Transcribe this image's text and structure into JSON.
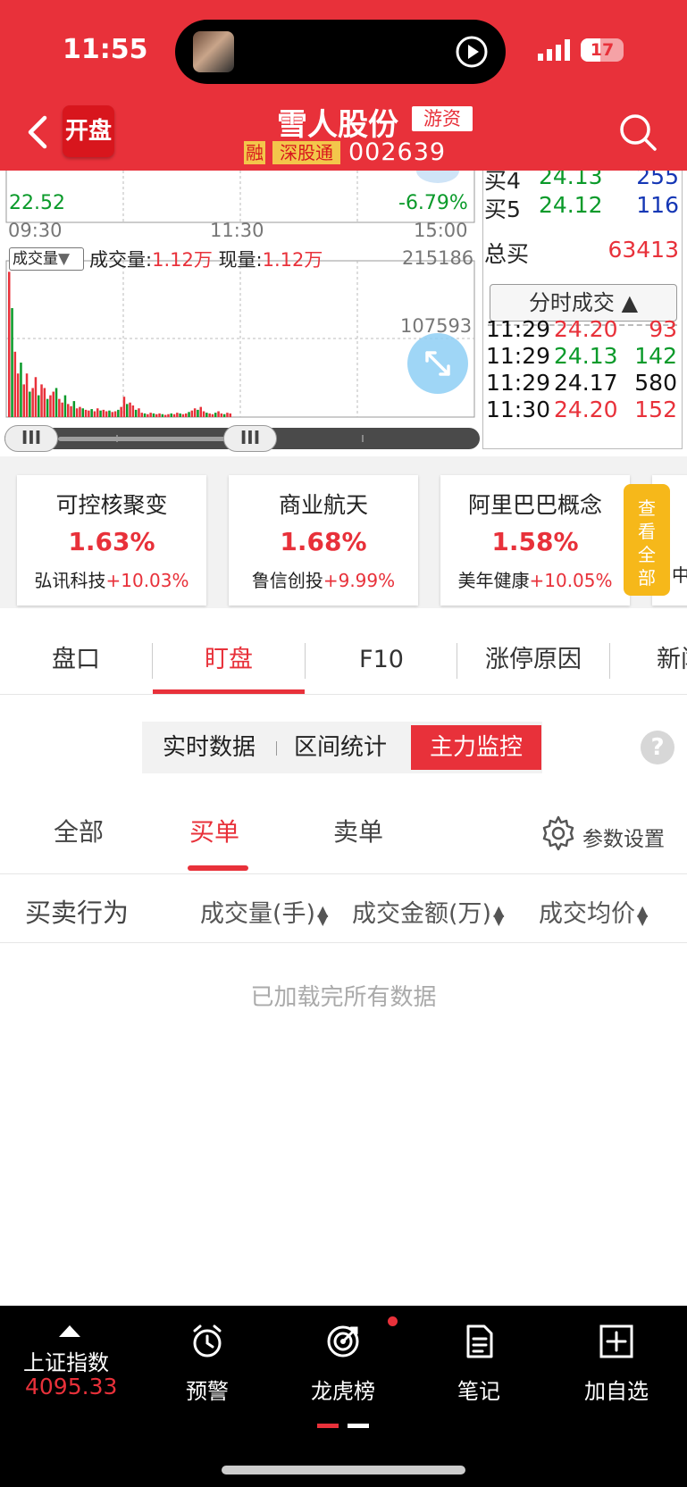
{
  "status_bar": {
    "time": "11:55",
    "battery": "17"
  },
  "header": {
    "kaipan_label": "开盘",
    "stock_name": "雪人股份",
    "tag": "游资",
    "rong": "融",
    "shen_gu_tong": "深股通",
    "code": "002639"
  },
  "chart": {
    "price_low": "22.52",
    "pct_low": "-6.79%",
    "time_labels": [
      "09:30",
      "11:30",
      "15:00"
    ],
    "volume_selector": "成交量",
    "volume_label": "成交量:",
    "volume_value": "1.12万",
    "current_label": "现量:",
    "current_value": "1.12万",
    "vol_max": "215186",
    "vol_mid": "107593"
  },
  "chart_data": {
    "type": "bar",
    "title": "",
    "ylim": [
      0,
      215186
    ],
    "values": [
      200000,
      150000,
      90000,
      60000,
      75000,
      45000,
      60000,
      35000,
      40000,
      55000,
      30000,
      45000,
      40000,
      25000,
      30000,
      35000,
      40000,
      25000,
      20000,
      30000,
      18000,
      15000,
      22000,
      12000,
      14000,
      12000,
      10000,
      9000,
      11000,
      8000,
      12000,
      9000,
      10000,
      8000,
      9000,
      7000,
      8000,
      10000,
      14000,
      28000,
      18000,
      20000,
      16000,
      10000,
      12000,
      6000,
      5000,
      4000,
      6000,
      5000,
      4000,
      5000,
      4000,
      3000,
      4000,
      5000,
      4000,
      6000,
      5000,
      4000,
      5000,
      7000,
      9000,
      12000,
      10000,
      14000,
      8000,
      6000,
      5000,
      4000,
      6000,
      8000,
      5000,
      4000,
      6000,
      5000
    ]
  },
  "order_book": [
    {
      "label": "买4",
      "price": "24.13",
      "volume": "255"
    },
    {
      "label": "买5",
      "price": "24.12",
      "volume": "116"
    }
  ],
  "total_buy": {
    "label": "总买",
    "value": "63413"
  },
  "fs_button": "分时成交",
  "trades": [
    {
      "time": "11:29",
      "price": "24.20",
      "vol": "93",
      "color": "#e8313a"
    },
    {
      "time": "11:29",
      "price": "24.13",
      "vol": "142",
      "color": "#0a9a2a"
    },
    {
      "time": "11:29",
      "price": "24.17",
      "vol": "580",
      "color": "#111111"
    },
    {
      "time": "11:30",
      "price": "24.20",
      "vol": "152",
      "color": "#e8313a"
    }
  ],
  "concepts": [
    {
      "name": "可控核聚变",
      "pct": "1.63%",
      "leader": "弘讯科技",
      "leader_pct": "+10.03%"
    },
    {
      "name": "商业航天",
      "pct": "1.68%",
      "leader": "鲁信创投",
      "leader_pct": "+9.99%"
    },
    {
      "name": "阿里巴巴概念",
      "pct": "1.58%",
      "leader": "美年健康",
      "leader_pct": "+10.05%"
    }
  ],
  "view_all": [
    "查",
    "看",
    "全",
    "部"
  ],
  "view_all_partial": "中",
  "tabs": [
    "盘口",
    "盯盘",
    "F10",
    "涨停原因",
    "新闻"
  ],
  "segments": [
    "实时数据",
    "区间统计",
    "主力监控"
  ],
  "help": "?",
  "sub_tabs": [
    "全部",
    "买单",
    "卖单"
  ],
  "param_settings": "参数设置",
  "table_headers": [
    "买卖行为",
    "成交量(手)",
    "成交金额(万)",
    "成交均价"
  ],
  "empty_text": "已加载完所有数据",
  "bottom_nav": {
    "index_name": "上证指数",
    "index_value": "4095.33",
    "items": [
      "预警",
      "龙虎榜",
      "笔记",
      "加自选"
    ]
  }
}
